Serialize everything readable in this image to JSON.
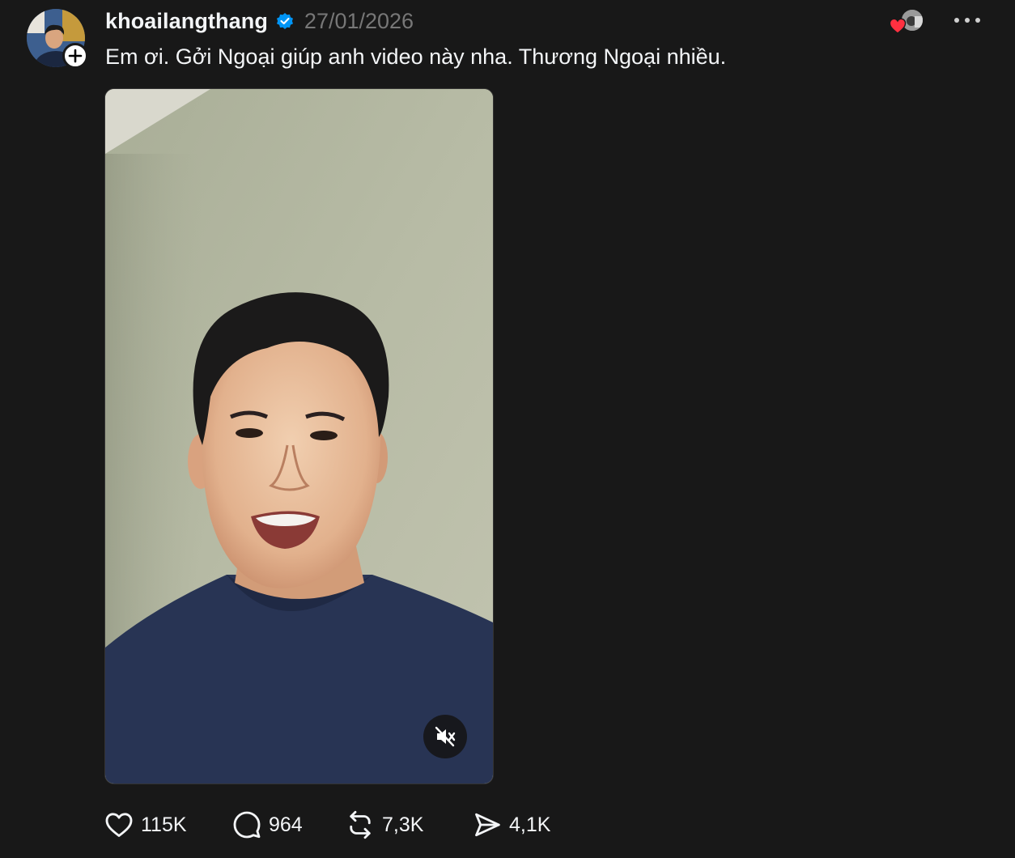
{
  "post": {
    "username": "khoailangthang",
    "timestamp": "27/01/2026",
    "caption": "Em ơi. Gởi Ngoại giúp anh video này nha. Thương Ngoại nhiều.",
    "verified": true
  },
  "actions": {
    "likes": "115K",
    "replies": "964",
    "reposts": "7,3K",
    "shares": "4,1K"
  },
  "icons": {
    "avatar": "user-avatar",
    "follow": "plus-icon",
    "verified": "verified-badge-icon",
    "reactor_heart": "heart-icon",
    "more": "more-icon",
    "mute": "muted-speaker-icon",
    "like": "heart-outline-icon",
    "reply": "comment-bubble-icon",
    "repost": "repost-icon",
    "share": "send-icon"
  },
  "colors": {
    "background": "#181818",
    "text": "#f3f5f7",
    "muted_text": "#777777",
    "verified_blue": "#0095f6",
    "heart_red": "#ff3040"
  }
}
